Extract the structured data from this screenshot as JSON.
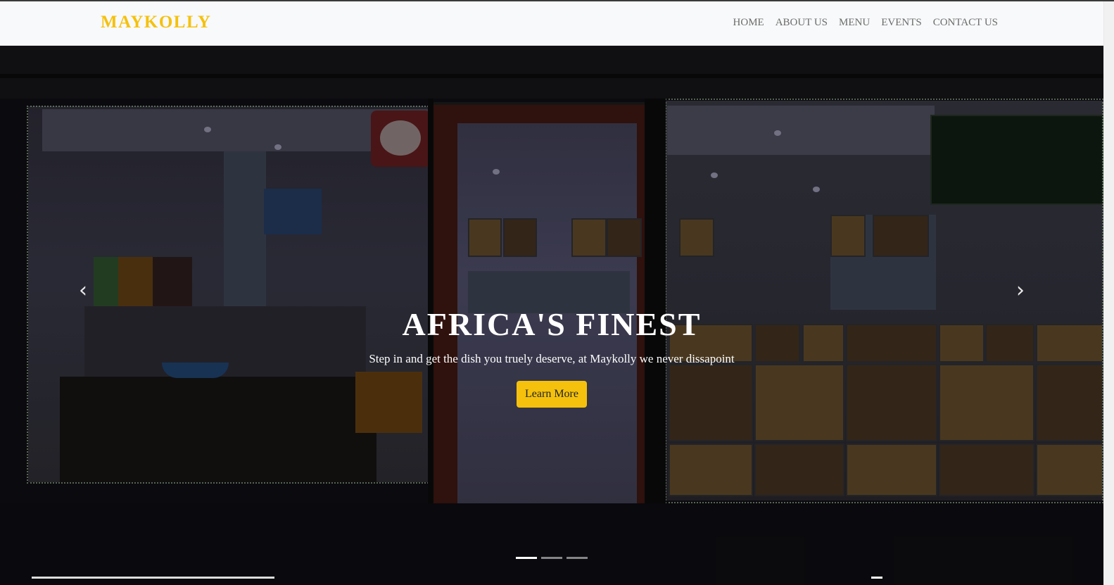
{
  "brand": {
    "name": "MAYKOLLY"
  },
  "nav": {
    "items": [
      {
        "label": "HOME"
      },
      {
        "label": "ABOUT US"
      },
      {
        "label": "MENU"
      },
      {
        "label": "EVENTS"
      },
      {
        "label": "CONTACT US"
      }
    ]
  },
  "hero": {
    "title": "AFRICA'S FINEST",
    "subtitle": "Step in and get the dish you truely deserve, at Maykolly we never dissapoint",
    "button_label": "Learn More",
    "prev_icon": "‹",
    "next_icon": "›",
    "slides_count": 3,
    "active_slide": 1
  },
  "colors": {
    "accent": "#f5c10c",
    "nav_bg": "#f8f9fa",
    "nav_text": "#6c6c6c"
  }
}
